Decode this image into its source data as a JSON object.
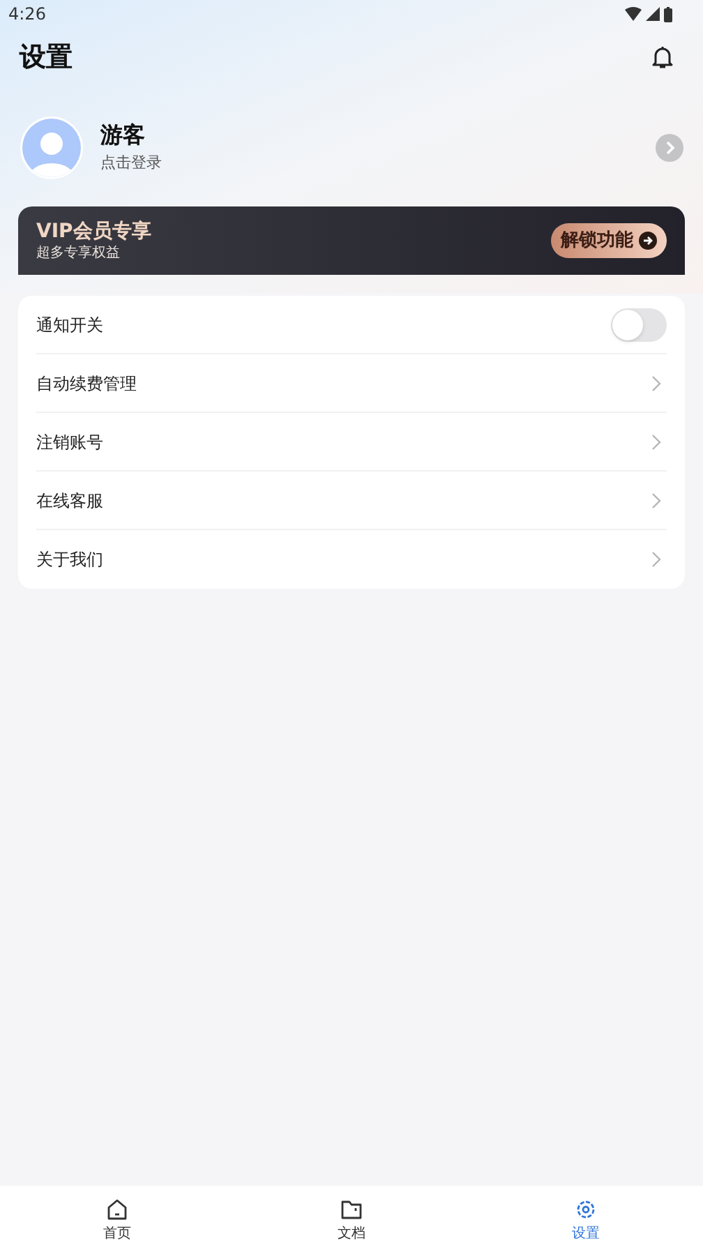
{
  "status_bar": {
    "time": "4:26"
  },
  "header": {
    "title": "设置"
  },
  "profile": {
    "name": "游客",
    "subtitle": "点击登录"
  },
  "vip_banner": {
    "title": "VIP会员专享",
    "subtitle": "超多专享权益",
    "button": "解锁功能"
  },
  "settings": [
    {
      "kind": "toggle",
      "label": "通知开关",
      "on": false
    },
    {
      "kind": "link",
      "label": "自动续费管理"
    },
    {
      "kind": "link",
      "label": "注销账号"
    },
    {
      "kind": "link",
      "label": "在线客服"
    },
    {
      "kind": "link",
      "label": "关于我们"
    }
  ],
  "tabs": [
    {
      "kind": "home",
      "label": "首页",
      "selected": false
    },
    {
      "kind": "docs",
      "label": "文档",
      "selected": false
    },
    {
      "kind": "settings",
      "label": "设置",
      "selected": true
    }
  ]
}
